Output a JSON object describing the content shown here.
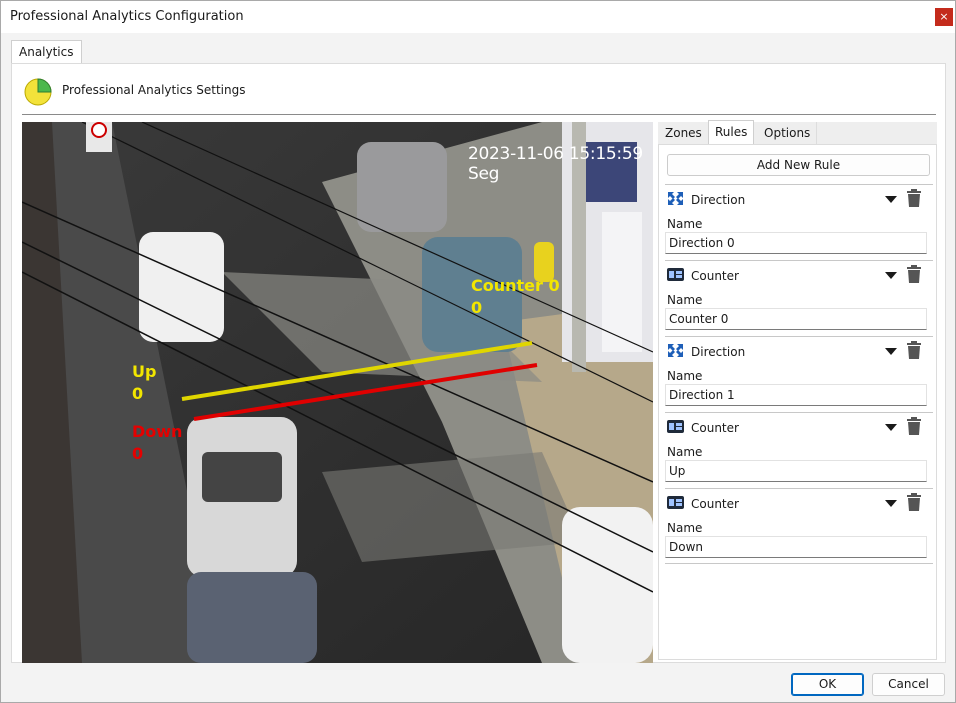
{
  "window": {
    "title": "Professional Analytics Configuration",
    "close_glyph": "×"
  },
  "main_tab": {
    "label": "Analytics"
  },
  "header": {
    "title": "Professional Analytics Settings",
    "icon": "pie-chart-icon"
  },
  "video": {
    "timestamp": "2023-11-06 15:15:59 Seg",
    "overlays": [
      {
        "name": "Up",
        "value": "0",
        "color": "#f2e600"
      },
      {
        "name": "Down",
        "value": "0",
        "color": "#e60000"
      },
      {
        "name": "Counter 0",
        "value": "0",
        "color": "#f2e600"
      }
    ]
  },
  "side_tabs": [
    {
      "label": "Zones",
      "active": false
    },
    {
      "label": "Rules",
      "active": true
    },
    {
      "label": "Options",
      "active": false
    }
  ],
  "add_rule_label": "Add New Rule",
  "rules": [
    {
      "type": "Direction",
      "icon": "direction-arrows-icon",
      "name_label": "Name",
      "name": "Direction 0"
    },
    {
      "type": "Counter",
      "icon": "counter-icon",
      "name_label": "Name",
      "name": "Counter 0"
    },
    {
      "type": "Direction",
      "icon": "direction-arrows-icon",
      "name_label": "Name",
      "name": "Direction 1"
    },
    {
      "type": "Counter",
      "icon": "counter-icon",
      "name_label": "Name",
      "name": "Up"
    },
    {
      "type": "Counter",
      "icon": "counter-icon",
      "name_label": "Name",
      "name": "Down"
    }
  ],
  "buttons": {
    "ok": "OK",
    "cancel": "Cancel"
  },
  "colors": {
    "accent": "#0067c0",
    "close": "#c42b1c",
    "up_line": "#e0d600",
    "down_line": "#e00000"
  }
}
